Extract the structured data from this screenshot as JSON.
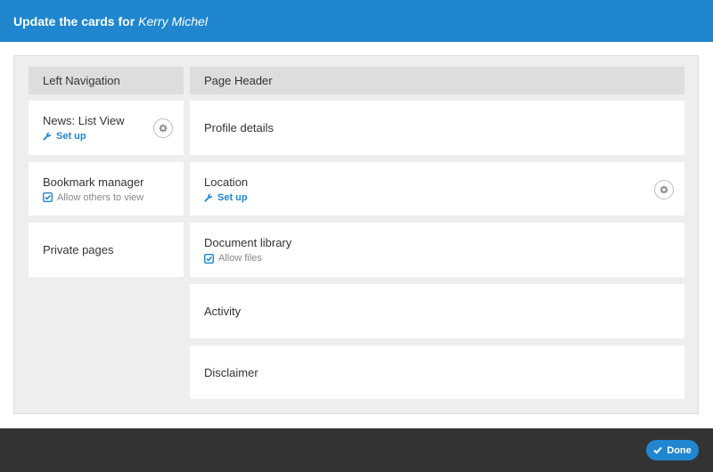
{
  "dialog": {
    "title_prefix": "Update the cards for",
    "user_name": "Kerry Michel"
  },
  "left_column": {
    "header": "Left Navigation",
    "cards": [
      {
        "title": "News: List View",
        "action": "Set up"
      },
      {
        "title": "Bookmark manager",
        "option": "Allow others to view"
      },
      {
        "title": "Private pages"
      }
    ]
  },
  "right_column": {
    "header": "Page Header",
    "cards": [
      {
        "title": "Profile details"
      },
      {
        "title": "Location",
        "action": "Set up"
      },
      {
        "title": "Document library",
        "option": "Allow files"
      },
      {
        "title": "Activity"
      },
      {
        "title": "Disclaimer"
      }
    ]
  },
  "footer": {
    "done_label": "Done"
  },
  "colors": {
    "accent": "#1f86cf",
    "footer_bg": "#333333",
    "board_bg": "#eeeeee",
    "column_header_bg": "#dddddd"
  },
  "icons": {
    "setup": "wrench-icon",
    "option": "checkbox-checked-icon",
    "settings": "gear-icon",
    "done": "checkmark-icon"
  }
}
